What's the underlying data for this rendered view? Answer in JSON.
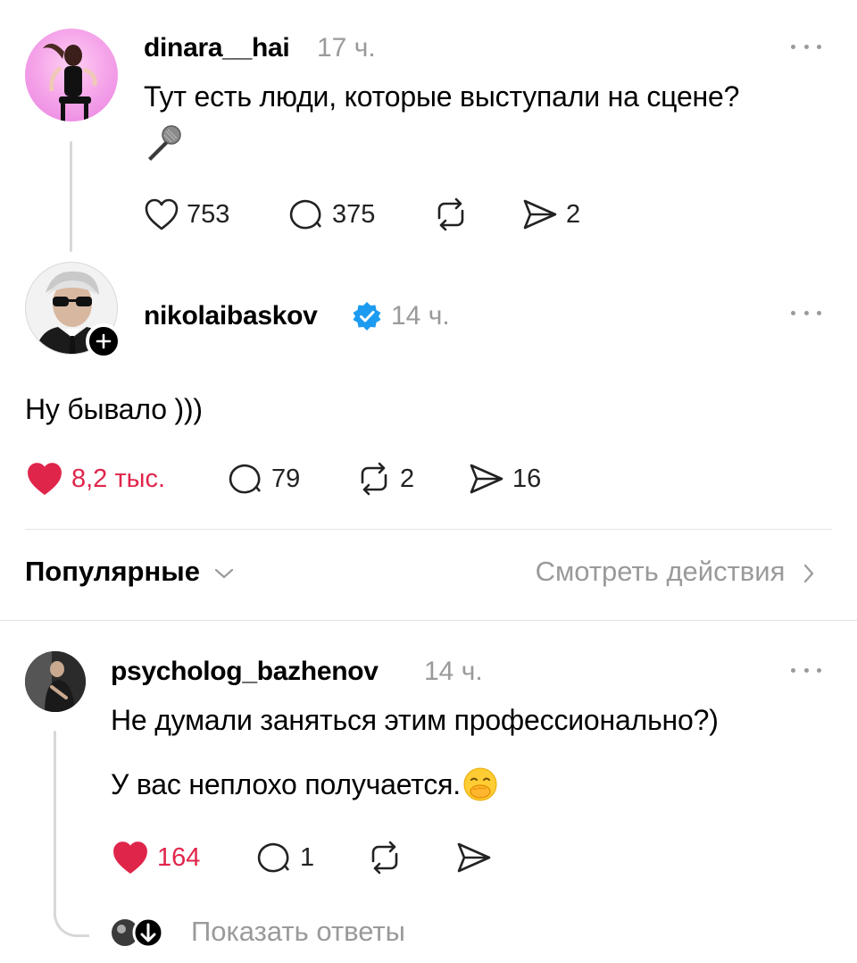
{
  "posts": [
    {
      "username": "dinara__hai",
      "time": "17 ч.",
      "text": "Тут есть люди, которые выступали на сцене?",
      "likes": "753",
      "comments": "375",
      "reposts": "",
      "shares": "2"
    },
    {
      "username": "nikolaibaskov",
      "verified": true,
      "time": "14 ч.",
      "text": "Ну бывало )))",
      "likes": "8,2 тыс.",
      "liked": true,
      "comments": "79",
      "reposts": "2",
      "shares": "16"
    }
  ],
  "filter": {
    "sort_label": "Популярные",
    "view_activity": "Смотреть действия"
  },
  "reply": {
    "username": "psycholog_bazhenov",
    "time": "14 ч.",
    "line1": "Не думали заняться этим профессионально?)",
    "line2": "У вас неплохо получается.",
    "likes": "164",
    "liked": true,
    "comments": "1",
    "show_replies": "Показать ответы"
  },
  "colors": {
    "like_red": "#e0254b",
    "muted": "#9a9a9a",
    "verified_blue": "#1d9bf0"
  },
  "icons": [
    "heart-icon",
    "comment-icon",
    "repost-icon",
    "share-icon",
    "more-icon",
    "verified-badge-icon",
    "chevron-down-icon",
    "chevron-right-icon",
    "plus-icon",
    "microphone-icon",
    "hand-over-mouth-emoji"
  ]
}
